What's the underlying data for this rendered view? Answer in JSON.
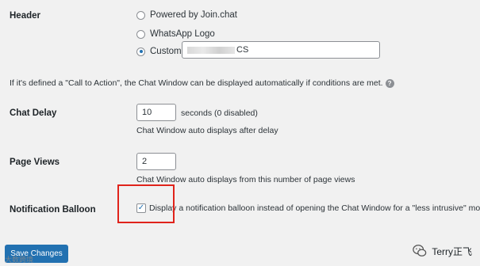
{
  "header": {
    "label": "Header",
    "options": [
      {
        "label": "Powered by Join.chat",
        "checked": false
      },
      {
        "label": "WhatsApp Logo",
        "checked": false
      },
      {
        "label": "Custom:",
        "checked": true
      }
    ],
    "custom_value_suffix": "CS"
  },
  "cta_note": "If it's defined a \"Call to Action\", the Chat Window can be displayed automatically if conditions are met.",
  "chat_delay": {
    "label": "Chat Delay",
    "value": "10",
    "unit": "seconds (0 disabled)",
    "description": "Chat Window auto displays after delay"
  },
  "page_views": {
    "label": "Page Views",
    "value": "2",
    "description": "Chat Window auto displays from this number of page views"
  },
  "notification_balloon": {
    "label": "Notification Balloon",
    "checked": true,
    "text": "Display a notification balloon instead of opening the Chat Window for a \"less intrusive\" mode"
  },
  "save_button": "Save Changes",
  "watermark": {
    "right": "Terry正飞",
    "left": "大数跨境"
  }
}
